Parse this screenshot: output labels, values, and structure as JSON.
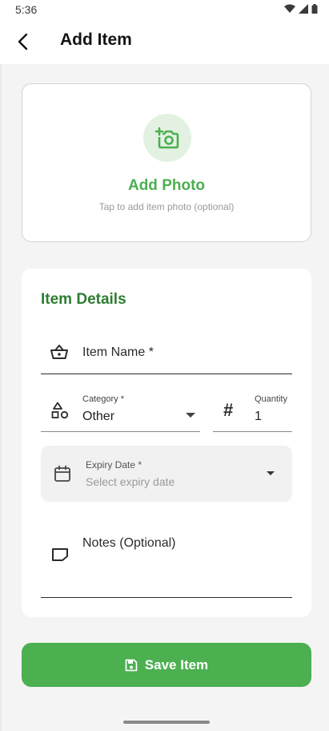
{
  "status_bar": {
    "time": "5:36"
  },
  "app_bar": {
    "title": "Add Item"
  },
  "photo": {
    "title": "Add Photo",
    "subtitle": "Tap to add item photo (optional)"
  },
  "details": {
    "section_title": "Item Details",
    "item_name_label": "Item Name *",
    "category": {
      "label": "Category *",
      "value": "Other"
    },
    "quantity": {
      "label": "Quantity",
      "value": "1"
    },
    "expiry": {
      "label": "Expiry Date *",
      "placeholder": "Select expiry date"
    },
    "notes_label": "Notes (Optional)"
  },
  "save_button": {
    "label": "Save Item"
  },
  "colors": {
    "primary_green": "#4caf50",
    "heading_green": "#2e7d32",
    "photo_circle_bg": "#e3f1e3"
  }
}
